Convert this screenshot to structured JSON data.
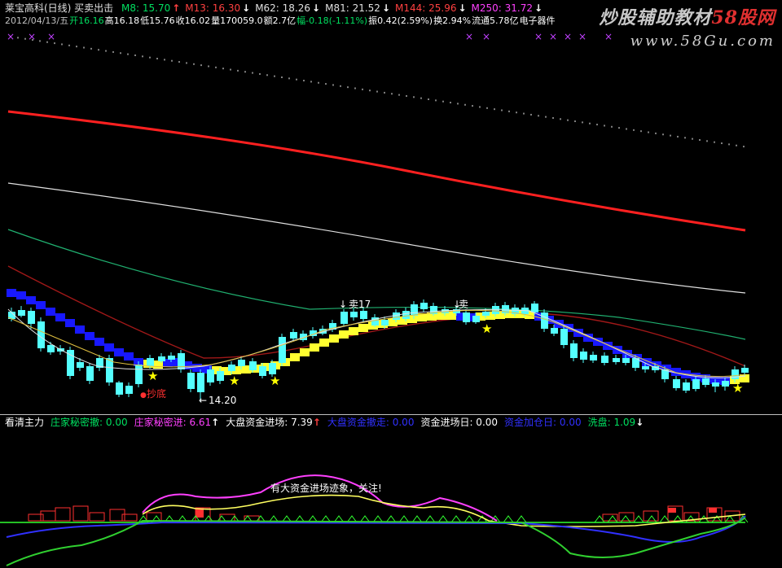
{
  "header": {
    "title": "莱宝高科(日线) 买卖出击",
    "mas": [
      {
        "label": "M8: 15.70",
        "arrow": "↑",
        "color": "#00e060",
        "arrow_color": "#ff4040"
      },
      {
        "label": "M13: 16.30",
        "arrow": "↓",
        "color": "#ff4040",
        "arrow_color": "#ffffff"
      },
      {
        "label": "M62: 18.26",
        "arrow": "↓",
        "color": "#e0e0e0",
        "arrow_color": "#ffffff"
      },
      {
        "label": "M81: 21.52",
        "arrow": "↓",
        "color": "#e0e0e0",
        "arrow_color": "#ffffff"
      },
      {
        "label": "M144: 25.96",
        "arrow": "↓",
        "color": "#ff4040",
        "arrow_color": "#ffffff"
      },
      {
        "label": "M250: 31.72",
        "arrow": "↓",
        "color": "#ff40ff",
        "arrow_color": "#ffffff"
      }
    ],
    "quote": [
      {
        "text": "2012/04/13/五",
        "color": "#c0c0c0"
      },
      {
        "text": "开16.16",
        "color": "#00e060"
      },
      {
        "text": "高16.18",
        "color": "#ffffff"
      },
      {
        "text": "低15.76",
        "color": "#ffffff"
      },
      {
        "text": "收16.02",
        "color": "#ffffff"
      },
      {
        "text": "量170059.0",
        "color": "#ffffff"
      },
      {
        "text": "额2.7亿",
        "color": "#ffffff"
      },
      {
        "text": "幅-0.18(-1.11%)",
        "color": "#00e060"
      },
      {
        "text": "振0.42(2.59%)",
        "color": "#ffffff"
      },
      {
        "text": "换2.94%",
        "color": "#ffffff"
      },
      {
        "text": "流通5.78亿",
        "color": "#ffffff"
      },
      {
        "text": "电子器件",
        "color": "#ffffff"
      }
    ]
  },
  "watermark": {
    "title_main": "炒股辅助教材",
    "title_accent": "58股网",
    "url": "www.58Gu.com"
  },
  "annotations": {
    "sell_17": "卖17",
    "sell": "卖",
    "bottom_pick": "抄底",
    "low_price": "14.20",
    "fund_entry": "有大资金进场迹象，关注!"
  },
  "indicator_header": [
    {
      "text": "看清主力",
      "color": "#ffffff"
    },
    {
      "text": "庄家秘密撤: 0.00",
      "color": "#00e060"
    },
    {
      "text": "庄家秘密进: 6.61",
      "color": "#ff40ff",
      "arrow": "↑",
      "arrow_color": "#ffffff"
    },
    {
      "text": "大盘资金进场: 7.39",
      "color": "#ffffff",
      "arrow": "↑",
      "arrow_color": "#ff4040"
    },
    {
      "text": "大盘资金撤走: 0.00",
      "color": "#3030ff"
    },
    {
      "text": "资金进场日: 0.00",
      "color": "#ffffff"
    },
    {
      "text": "资金加仓日: 0.00",
      "color": "#3030ff"
    },
    {
      "text": "洗盘: 1.09",
      "color": "#00e060",
      "arrow": "↓",
      "arrow_color": "#ffffff"
    }
  ],
  "colors": {
    "up_candle": "#ff3030",
    "down_candle": "#54ffff",
    "ma_red": "#ff2020",
    "ma_white": "#e0e0e0",
    "ma_green": "#20b070",
    "ma_darkred": "#a01818",
    "band_blue": "#1818ff",
    "band_yellow": "#ffff30",
    "star": "#ffff00",
    "cross": "#c040ff"
  }
}
